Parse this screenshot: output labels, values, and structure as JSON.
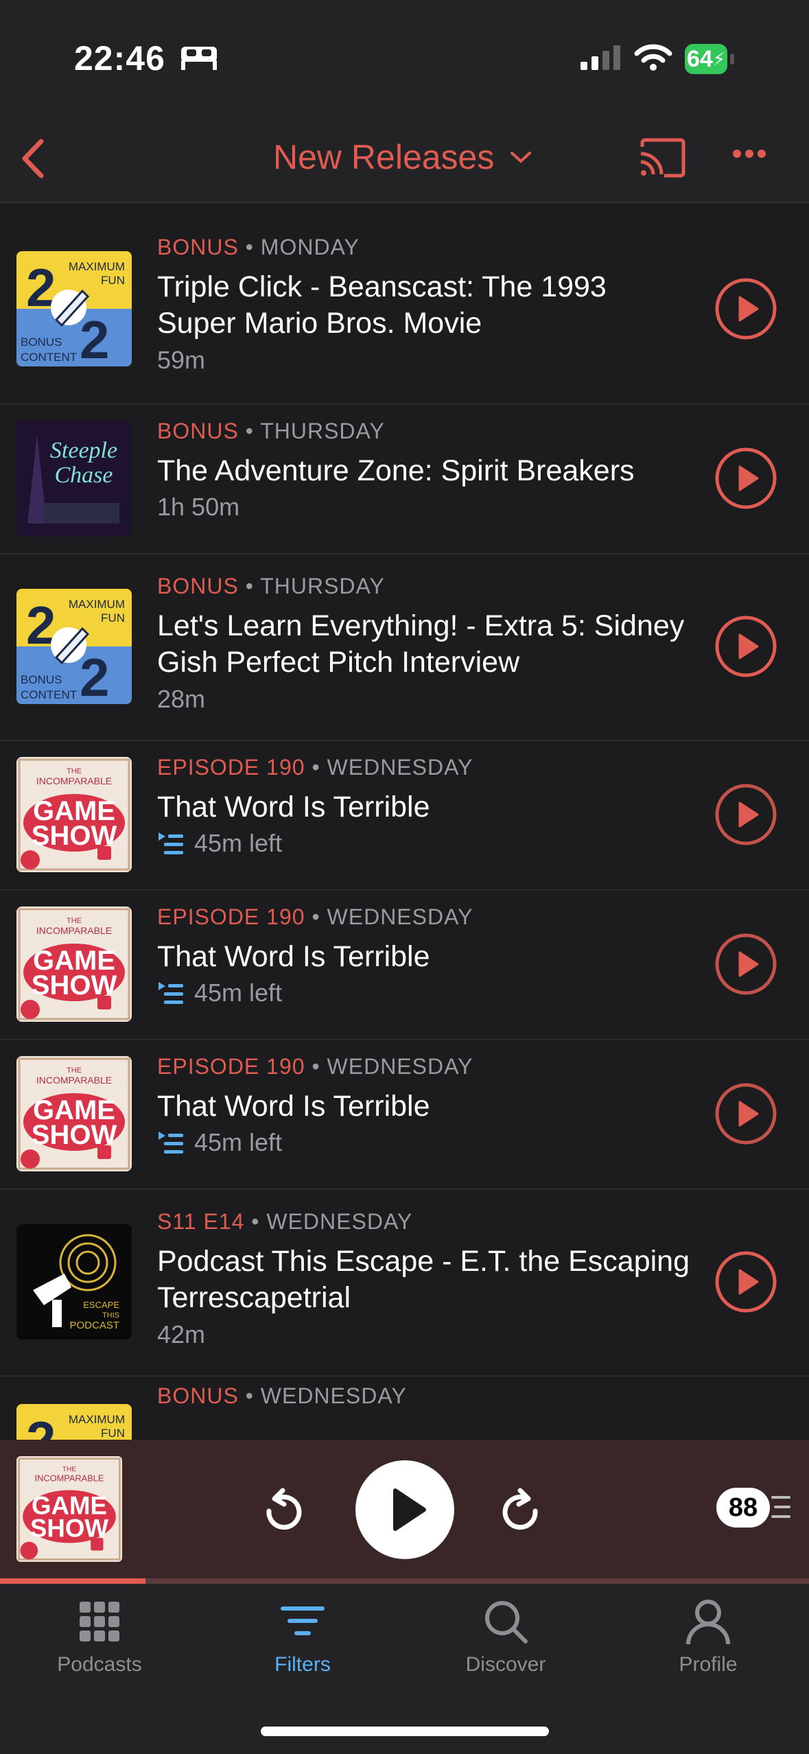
{
  "status_bar": {
    "time": "22:46",
    "battery": "64"
  },
  "nav": {
    "title": "New Releases"
  },
  "episodes": [
    {
      "type": "BONUS",
      "date": "MONDAY",
      "title": "Triple Click - Beanscast: The 1993 Super Mario Bros. Movie",
      "duration": "59m",
      "art": "mf"
    },
    {
      "type": "BONUS",
      "date": "THURSDAY",
      "title": "The Adventure Zone: Spirit Breakers",
      "duration": "1h 50m",
      "art": "steeple"
    },
    {
      "type": "BONUS",
      "date": "THURSDAY",
      "title": "Let's Learn Everything! - Extra 5: Sidney Gish Perfect Pitch Interview",
      "duration": "28m",
      "art": "mf"
    },
    {
      "type": "EPISODE 190",
      "date": "WEDNESDAY",
      "title": "That Word Is Terrible",
      "duration": "45m left",
      "art": "game"
    },
    {
      "type": "EPISODE 190",
      "date": "WEDNESDAY",
      "title": "That Word Is Terrible",
      "duration": "45m left",
      "art": "game"
    },
    {
      "type": "EPISODE 190",
      "date": "WEDNESDAY",
      "title": "That Word Is Terrible",
      "duration": "45m left",
      "art": "game"
    },
    {
      "type": "S11 E14",
      "date": "WEDNESDAY",
      "title": "Podcast This Escape - E.T. the Escaping Terrescapetrial",
      "duration": "42m",
      "art": "escape"
    },
    {
      "type": "BONUS",
      "date": "WEDNESDAY",
      "title": "",
      "duration": "",
      "art": "mf"
    }
  ],
  "art_text": {
    "mf_top": "MAXIMUM",
    "mf_fun": "FUN",
    "mf_bonus": "BONUS",
    "mf_content": "CONTENT",
    "steeple_line1": "Steeple",
    "steeple_line2": "Chase",
    "game_the": "THE",
    "game_incomparable": "INCOMPARABLE",
    "game_game": "GAME",
    "game_show": "SHOW",
    "escape_1": "ESCAPE",
    "escape_2": "THIS",
    "escape_3": "PODCAST"
  },
  "player": {
    "speed": "88",
    "progress": 0.18
  },
  "tabs": [
    {
      "label": "Podcasts",
      "icon": "grid-icon"
    },
    {
      "label": "Filters",
      "icon": "filters-icon",
      "active": true
    },
    {
      "label": "Discover",
      "icon": "search-icon"
    },
    {
      "label": "Profile",
      "icon": "profile-icon"
    }
  ],
  "colors": {
    "accent": "#e05c52",
    "tab_active": "#5ab0f0",
    "background": "#1c1c1e",
    "mini_player": "#3a2626"
  }
}
